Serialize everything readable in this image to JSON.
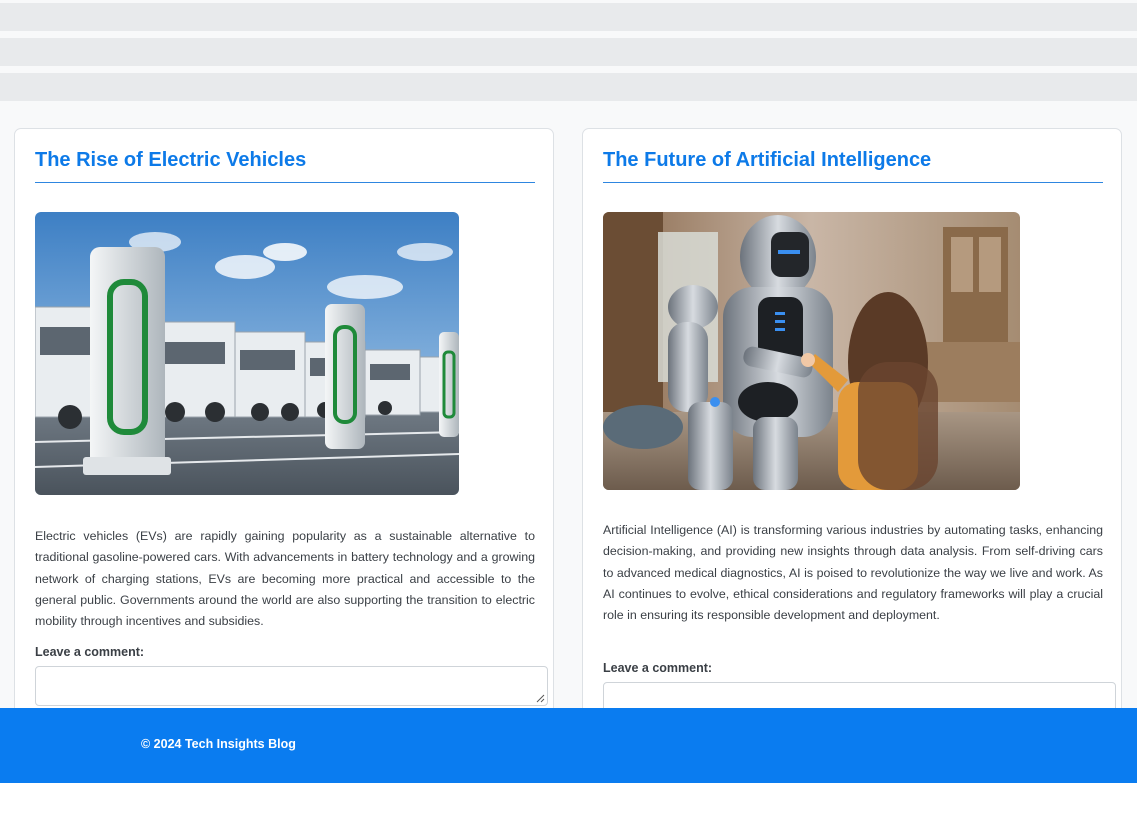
{
  "articles": [
    {
      "title": "The Rise of Electric Vehicles",
      "image": "ev-charging-stations-trucks",
      "body": "Electric vehicles (EVs) are rapidly gaining popularity as a sustainable alternative to traditional gasoline-powered cars. With advancements in battery technology and a growing network of charging stations, EVs are becoming more practical and accessible to the general public. Governments around the world are also supporting the transition to electric mobility through incentives and subsidies.",
      "comment_label": "Leave a comment:",
      "comment_value": ""
    },
    {
      "title": "The Future of Artificial Intelligence",
      "image": "robot-and-girl-high-five",
      "body": "Artificial Intelligence (AI) is transforming various industries by automating tasks, enhancing decision-making, and providing new insights through data analysis. From self-driving cars to advanced medical diagnostics, AI is poised to revolutionize the way we live and work. As AI continues to evolve, ethical considerations and regulatory frameworks will play a crucial role in ensuring its responsible development and deployment.",
      "comment_label": "Leave a comment:",
      "comment_value": ""
    }
  ],
  "footer": {
    "text": "© 2024 Tech Insights Blog"
  },
  "colors": {
    "accent": "#0d7ae8",
    "footer_bg": "#0a7cf0",
    "page_bg": "#f8f9fa",
    "text": "#3a3f45"
  }
}
